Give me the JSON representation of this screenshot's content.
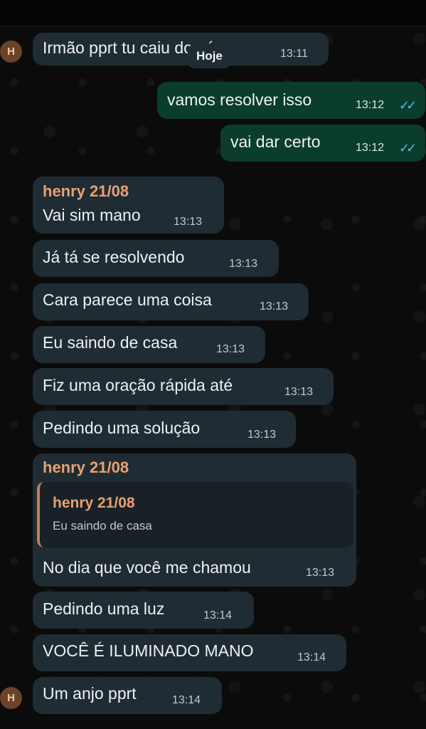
{
  "date_chip": "Hoje",
  "avatar_initial": "H",
  "messages": [
    {
      "text": "Irmão pprt tu caiu do céu",
      "time": "13:11"
    },
    {
      "text": "vamos resolver isso",
      "time": "13:12",
      "checks": "✓✓"
    },
    {
      "text": "vai dar certo",
      "time": "13:12",
      "checks": "✓✓"
    },
    {
      "sender": "henry 21/08",
      "text": "Vai sim mano",
      "time": "13:13"
    },
    {
      "text": "Já tá se resolvendo",
      "time": "13:13"
    },
    {
      "text": "Cara parece uma coisa",
      "time": "13:13"
    },
    {
      "text": "Eu saindo de casa",
      "time": "13:13"
    },
    {
      "text": "Fiz uma oração rápida até",
      "time": "13:13"
    },
    {
      "text": "Pedindo uma solução",
      "time": "13:13"
    },
    {
      "sender": "henry 21/08",
      "quote": {
        "sender": "henry 21/08",
        "text": "Eu saindo de casa"
      },
      "text": "No dia que você me chamou",
      "time": "13:13"
    },
    {
      "text": "Pedindo uma luz",
      "time": "13:14"
    },
    {
      "text": "VOCÊ É ILUMINADO MANO",
      "time": "13:14"
    },
    {
      "text": "Um anjo pprt",
      "time": "13:14"
    }
  ],
  "colors": {
    "background": "#0b0b0b",
    "incoming_bubble": "#202c33",
    "outgoing_bubble": "#0a3d2d",
    "sender_name": "#e9a073",
    "read_checks": "#53bdeb"
  },
  "icons": {
    "avatar": "avatar-initial",
    "read_receipt": "double-check-icon"
  }
}
